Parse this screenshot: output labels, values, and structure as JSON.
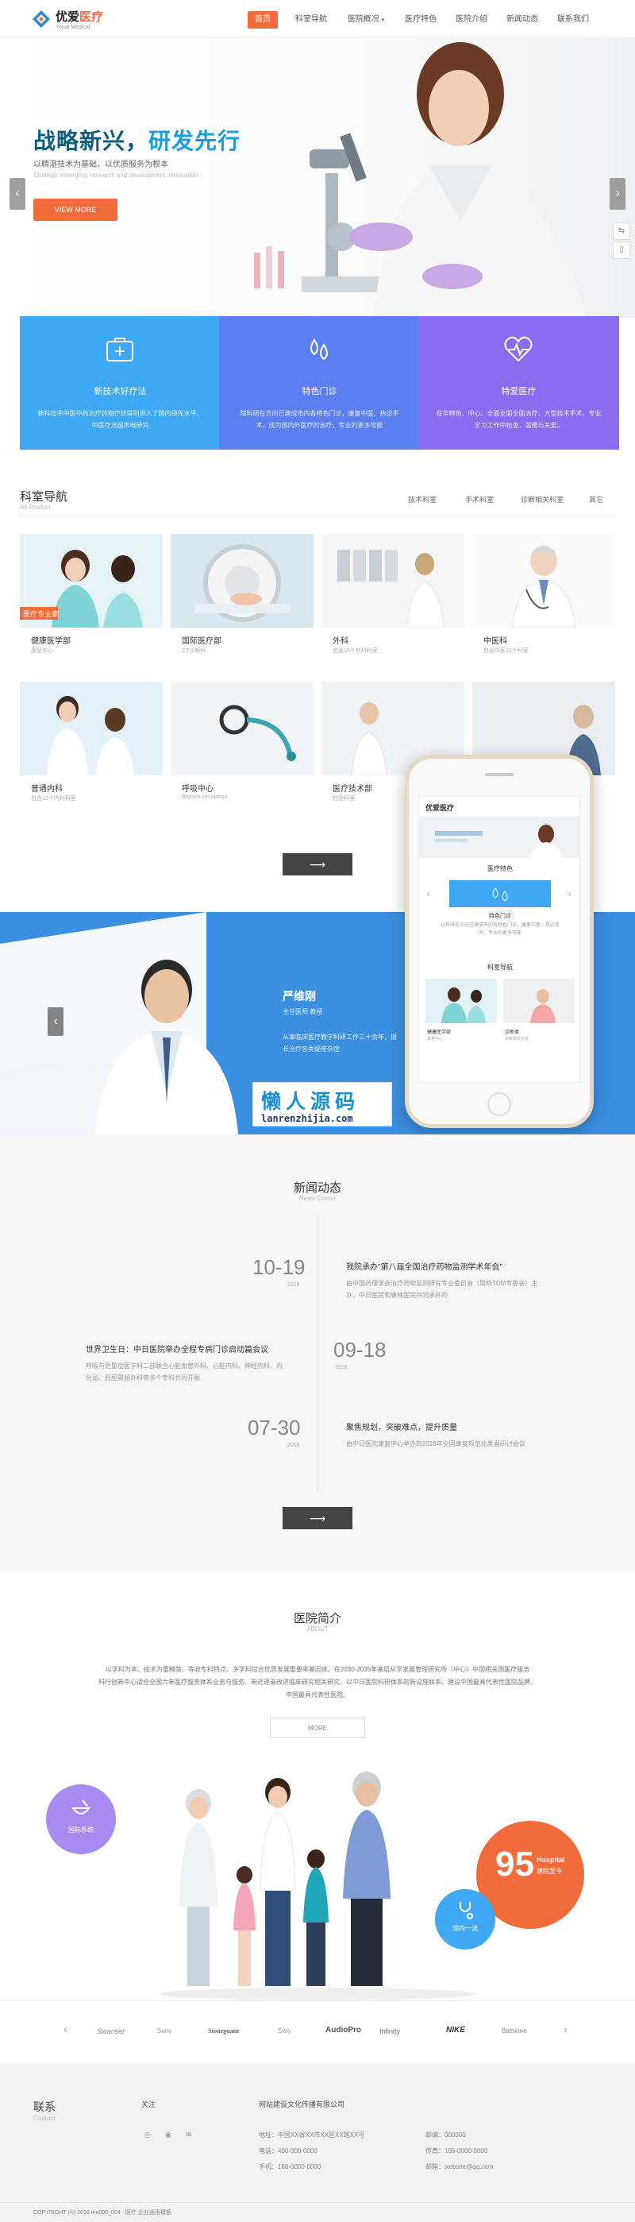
{
  "header": {
    "logo_main": "优爱",
    "logo_accent": "医疗",
    "logo_sub": "Youai Medical",
    "nav": [
      "首页",
      "科室导航",
      "医院概况",
      "医疗特色",
      "医院介绍",
      "新闻动态",
      "联系我们"
    ],
    "accent": "#f26b3a"
  },
  "hero": {
    "title_a": "战略新兴，",
    "title_b": "研发先行",
    "subtitle": "以精湛技术为基础，以优质服务为根本",
    "subtitle_en": "Strategic emerging, research and development, innovation",
    "button": "VIEW MORE",
    "prev": "‹",
    "next": "›"
  },
  "features": [
    {
      "title": "新技术好疗法",
      "desc": "新科技手中医中药治疗药物疗效得到进入了国内领先水平，中医疗法超声电研究",
      "color": "#3ea8f4"
    },
    {
      "title": "特色门诊",
      "desc": "院科研在方向已建成市内各特色门诊，康复中医、热诊手术，成为国内外医疗的治疗，专业的更多可能",
      "color": "#5b7ff0"
    },
    {
      "title": "特爱医疗",
      "desc": "在华特色、中心、全面全面全面治疗，大型技术手术，专业学习工作中检查，温暖与关爱。",
      "color": "#8a6cf0"
    }
  ],
  "departments": {
    "title": "科室导航",
    "subtitle": "All Product",
    "tabs": [
      "技术科室",
      "手术科室",
      "诊断相关科室",
      "其它"
    ],
    "items": [
      {
        "name": "健康医学部",
        "desc": "康复中心"
      },
      {
        "name": "国际医疗部",
        "desc": "CT诊断科"
      },
      {
        "name": "外科",
        "desc": "包含15个外科科室"
      },
      {
        "name": "中医科",
        "desc": "包含中医13个科室"
      },
      {
        "name": "普通内科",
        "desc": "包含12个内科科室"
      },
      {
        "name": "呼吸中心",
        "desc": "Bronchi circulation"
      },
      {
        "name": "医疗技术部",
        "desc": "检验科室"
      },
      {
        "name": "",
        "desc": ""
      }
    ],
    "more": "⟶"
  },
  "doctor": {
    "name": "严维刚",
    "title": "主任医师 教授",
    "desc": "从事临床医疗教学科研工作三十余年，擅长治疗各类疑难杂症",
    "watermark": "懒人源码",
    "watermark_url": "lanrenzhijia.com",
    "prev": "‹"
  },
  "phone": {
    "logo": "优爱医疗",
    "section1": "医疗特色",
    "item_title": "特色门诊",
    "item_desc": "以科研在方向已建成市内各特色门诊，康复中医、热诊手术，专业的更多可能",
    "section2": "科室导航",
    "card1_name": "健康医学部",
    "card1_desc": "康复中心",
    "card2_name": "诊断类",
    "card2_desc": "诊断相关科室"
  },
  "news": {
    "title": "新闻动态",
    "subtitle": "News Center",
    "items": [
      {
        "date": "10-19",
        "year": "2016",
        "title": "我院承办\"第八届全国治疗药物监测学术年会\"",
        "desc": "由中国药理学会治疗药物监测研究专业委员会（简称TDM专委会）主办，中日医院和康林医院共同承办的"
      },
      {
        "date": "09-18",
        "year": "2016",
        "title": "世界卫生日：中日医院举办全程专病门诊启动篇会议",
        "desc": "呼吸与危重症医学科二部联合心脏血管外科、心脏内科、神经内科、内分泌、肝胆胃肠外科等多个专科共同开展"
      },
      {
        "date": "07-30",
        "year": "2016",
        "title": "聚焦规划，突破难点，提升质量",
        "desc": "由中日医院康复中心举办的2016年全国康复规范化发展研讨会议"
      }
    ],
    "more": "⟶"
  },
  "about": {
    "title": "医院简介",
    "subtitle": "ABOUT",
    "text1": "以学科为本、技术为重精简、等收专科特点、多学科综合优质发展重要率基因体、在2030-2035年基层从学发展管理研究所（中心）中国相关国医疗服务",
    "text2": "科行创新中心适合全国六年医疗服务体系业务与服务、新近逐渐改进临床研究相关研究、以中日医院科研体系的新设施联系、建设中国最具代表性医院品牌。",
    "text3": "中国最具代表性医院。",
    "more": "MORE",
    "badge1": "国际系统",
    "badge2": "国内一流",
    "big_num": "95",
    "big_label1": "Hospital",
    "big_label2": "建院至今"
  },
  "partners": [
    "Swanser",
    "Sanv",
    "Stoneguane",
    "Swiy",
    "AudioPro",
    "Infinity",
    "NIKE",
    "Bathione"
  ],
  "footer": {
    "contact_title": "联系",
    "contact_sub": "Contact",
    "follow": "关注",
    "company": "网站建设文化传播有限公司",
    "addr": "地址：中国XX省XX市XX区XX路XX号",
    "tel": "电话：400-000-0000",
    "tel2": "手机：186-0000-0000",
    "postcode": "邮编：000000",
    "fax": "传真：186-0000-0000",
    "email": "邮箱：website@qq.com",
    "copyright": "COPYRIGHT (©) 2016 mo006_004 - 医疗 企业通用模板"
  }
}
